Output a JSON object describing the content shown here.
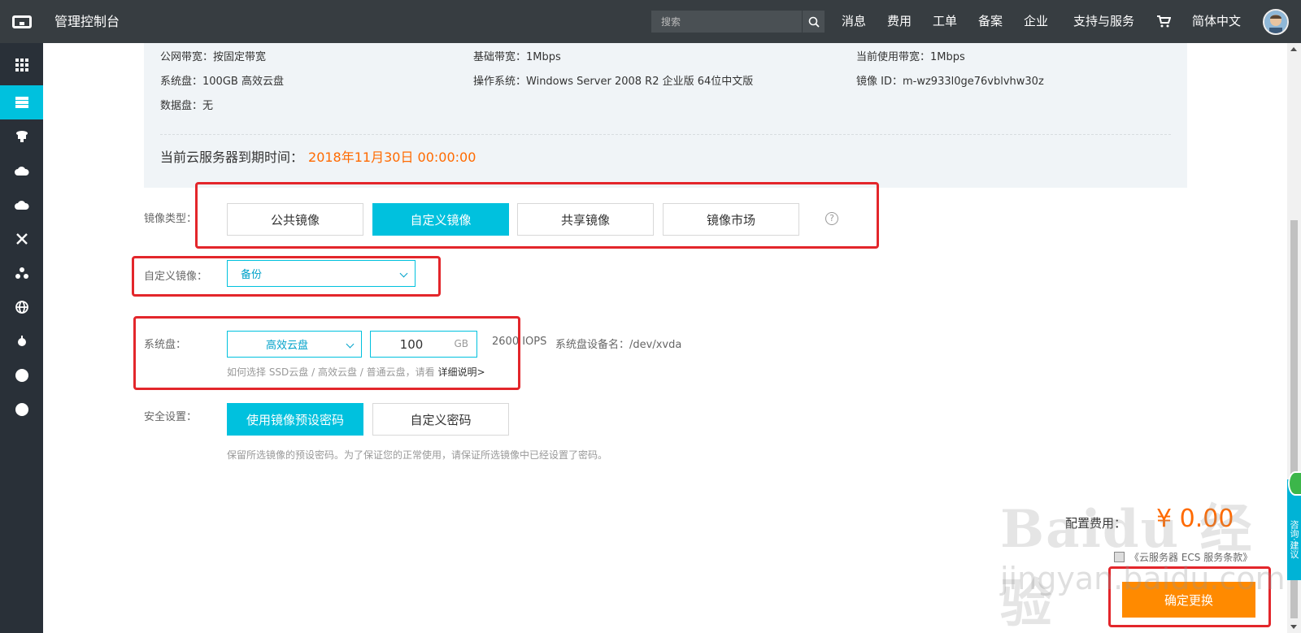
{
  "header": {
    "app_title": "管理控制台",
    "search_placeholder": "搜索",
    "nav": [
      "消息",
      "费用",
      "工单",
      "备案",
      "企业",
      "支持与服务"
    ],
    "language": "简体中文"
  },
  "info": {
    "public_bandwidth_label": "公网带宽：",
    "public_bandwidth": "按固定带宽",
    "base_bandwidth_label": "基础带宽：",
    "base_bandwidth": "1Mbps",
    "current_bandwidth_label": "当前使用带宽：",
    "current_bandwidth": "1Mbps",
    "system_disk_label": "系统盘：",
    "system_disk": "100GB 高效云盘",
    "os_label": "操作系统：",
    "os": "Windows Server 2008 R2 企业版 64位中文版",
    "image_id_label": "镜像 ID：",
    "image_id": "m-wz933l0ge76vblvhw30z",
    "data_disk_label": "数据盘：",
    "data_disk": "无",
    "expire_label": "当前云服务器到期时间：",
    "expire_date": "2018年11月30日 00:00:00"
  },
  "form": {
    "image_type_label": "镜像类型：",
    "image_types": [
      "公共镜像",
      "自定义镜像",
      "共享镜像",
      "镜像市场"
    ],
    "selected_image_type": "自定义镜像",
    "help_glyph": "?",
    "custom_image_label": "自定义镜像：",
    "custom_image_value": "备份",
    "system_disk_label": "系统盘：",
    "disk_type": "高效云盘",
    "disk_size": "100",
    "disk_unit": "GB",
    "iops": "2600 IOPS",
    "device_name": "系统盘设备名：/dev/xvda",
    "disk_hint": "如何选择 SSD云盘 / 高效云盘 / 普通云盘，请看",
    "disk_hint_link": "详细说明>",
    "security_label": "安全设置：",
    "security_options": [
      "使用镜像预设密码",
      "自定义密码"
    ],
    "selected_security": "使用镜像预设密码",
    "security_hint": "保留所选镜像的预设密码。为了保证您的正常使用，请保证所选镜像中已经设置了密码。"
  },
  "footer": {
    "fee_label": "配置费用：",
    "fee_value": "¥ 0.00",
    "agreement": "《云服务器 ECS 服务条款》",
    "confirm": "确定更换"
  },
  "consult": "咨询·建议",
  "watermark": {
    "main": "Bai du 经验",
    "sub": "jingyan.baidu.com"
  },
  "colors": {
    "topbar": "#373d41",
    "sidebar": "#293038",
    "accent": "#00c1de",
    "orange": "#ff6a00",
    "annotation": "#e3262b"
  }
}
